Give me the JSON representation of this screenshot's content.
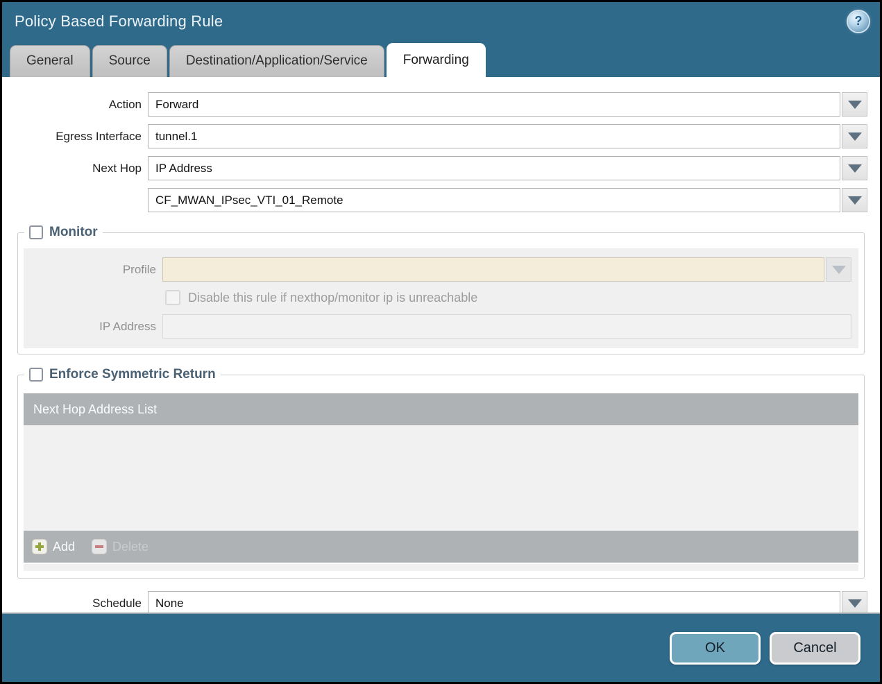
{
  "window": {
    "title": "Policy Based Forwarding Rule"
  },
  "icons": {
    "help": "?",
    "dropdown": "triangle-down",
    "add": "plus",
    "delete": "minus"
  },
  "tabs": [
    {
      "label": "General",
      "active": false
    },
    {
      "label": "Source",
      "active": false
    },
    {
      "label": "Destination/Application/Service",
      "active": false
    },
    {
      "label": "Forwarding",
      "active": true
    }
  ],
  "form": {
    "action": {
      "label": "Action",
      "value": "Forward"
    },
    "egress_interface": {
      "label": "Egress Interface",
      "value": "tunnel.1"
    },
    "next_hop": {
      "label": "Next Hop",
      "value": "IP Address"
    },
    "next_hop_address": {
      "value": "CF_MWAN_IPsec_VTI_01_Remote"
    },
    "schedule": {
      "label": "Schedule",
      "value": "None"
    }
  },
  "monitor": {
    "legend": "Monitor",
    "checked": false,
    "profile": {
      "label": "Profile",
      "value": ""
    },
    "disable_rule_label": "Disable this rule if nexthop/monitor ip is unreachable",
    "disable_rule_checked": false,
    "ip_address": {
      "label": "IP Address",
      "value": ""
    }
  },
  "symmetric_return": {
    "legend": "Enforce Symmetric Return",
    "checked": false,
    "table_header": "Next Hop Address List",
    "rows": [],
    "add_label": "Add",
    "delete_label": "Delete",
    "delete_enabled": false
  },
  "footer": {
    "ok_label": "OK",
    "cancel_label": "Cancel"
  },
  "colors": {
    "titlebar": "#2f6a8b",
    "active_tab": "#ffffff",
    "legend_text": "#4a6173",
    "disabled_field": "#f3edda",
    "table_bar": "#aeb2b5",
    "ok_button": "#6fa6bc",
    "cancel_button": "#c9cbce",
    "add_plus": "#93a73e",
    "delete_minus": "#c87f7f"
  }
}
